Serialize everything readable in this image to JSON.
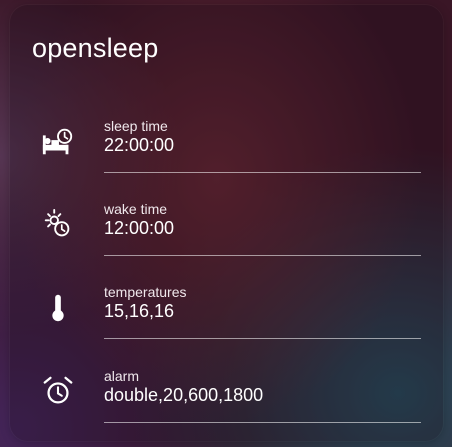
{
  "card": {
    "title": "opensleep",
    "entities": [
      {
        "name": "sleep time",
        "state": "22:00:00",
        "icon": "bed-clock-icon"
      },
      {
        "name": "wake time",
        "state": "12:00:00",
        "icon": "sun-clock-icon"
      },
      {
        "name": "temperatures",
        "state": "15,16,16",
        "icon": "thermometer-icon"
      },
      {
        "name": "alarm",
        "state": "double,20,600,1800",
        "icon": "alarm-clock-icon"
      }
    ]
  },
  "colors": {
    "text": "#ffffff",
    "divider": "#ffffff",
    "background": "#3a1626"
  }
}
